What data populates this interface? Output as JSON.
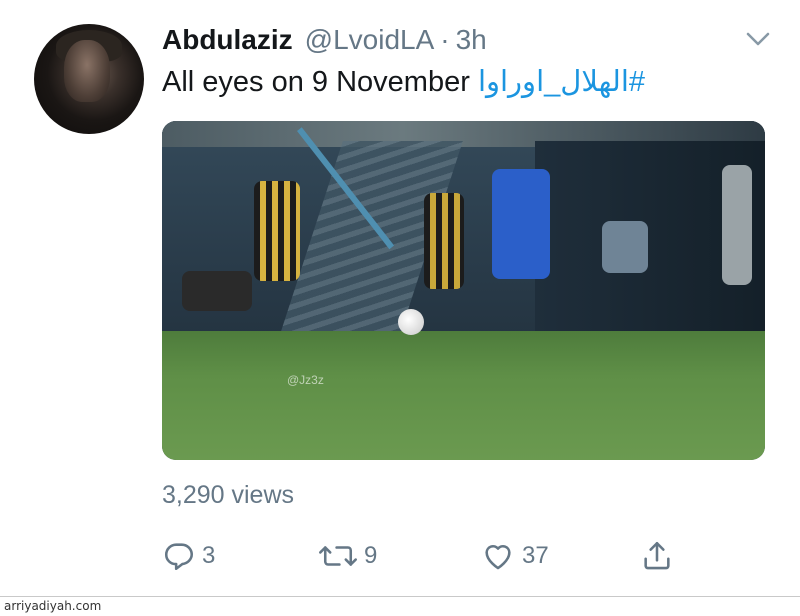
{
  "tweet": {
    "display_name": "Abdulaziz",
    "handle": "@LvoidLA",
    "separator": "·",
    "time": "3h",
    "text": "All eyes on 9 November",
    "hashtag": "#الهلال_اوراوا",
    "views": "3,290 views"
  },
  "media": {
    "watermark": "@Jz3z"
  },
  "actions": {
    "reply_count": "3",
    "retweet_count": "9",
    "like_count": "37"
  },
  "footer": {
    "site": "arriyadiyah.com"
  },
  "colors": {
    "link": "#1b95e0",
    "secondary_text": "#657786",
    "primary_text": "#14171a"
  },
  "icons": [
    "chevron-down-icon",
    "reply-icon",
    "retweet-icon",
    "like-icon",
    "share-icon"
  ]
}
